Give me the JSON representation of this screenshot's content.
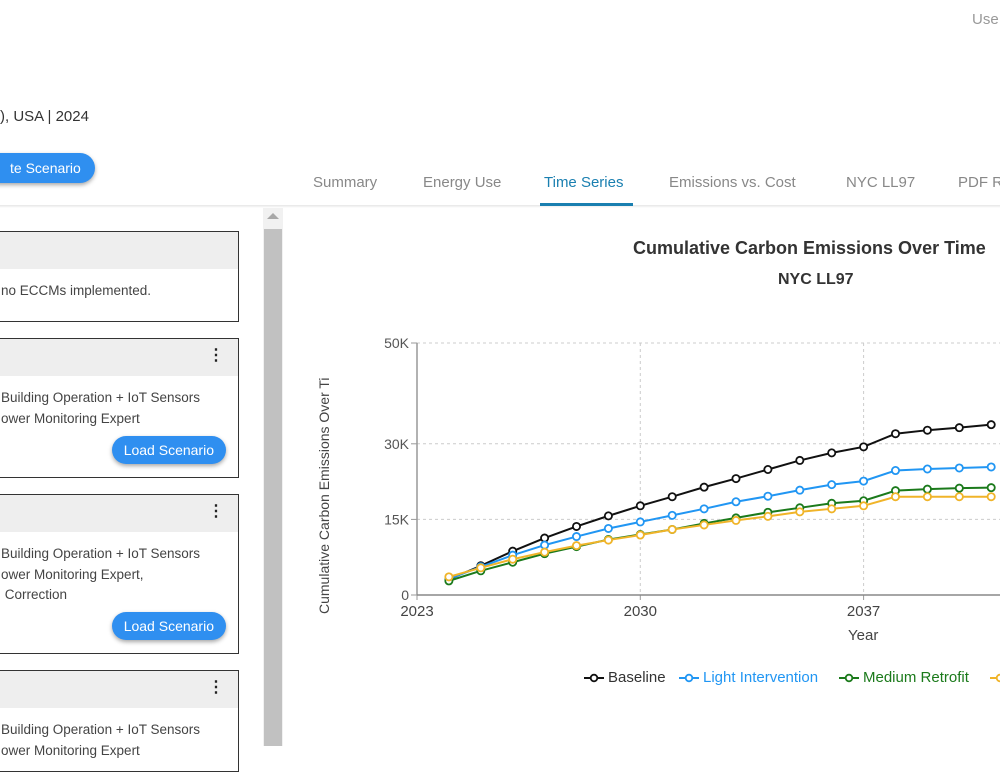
{
  "header": {
    "user_label": "Use",
    "subtitle": "), USA | 2024",
    "create_button": "te Scenario"
  },
  "tabs": [
    {
      "label": "Summary",
      "active": false
    },
    {
      "label": "Energy Use",
      "active": false
    },
    {
      "label": "Time Series",
      "active": true
    },
    {
      "label": "Emissions vs. Cost",
      "active": false
    },
    {
      "label": "NYC LL97",
      "active": false
    },
    {
      "label": "PDF R",
      "active": false
    }
  ],
  "scenarios": [
    {
      "lines": [
        "no ECCMs implemented."
      ],
      "has_menu": false,
      "load_label": ""
    },
    {
      "lines": [
        "Building Operation + IoT Sensors",
        "ower Monitoring Expert"
      ],
      "has_menu": true,
      "load_label": "Load Scenario"
    },
    {
      "lines": [
        "Building Operation + IoT Sensors",
        "ower Monitoring Expert,",
        " Correction"
      ],
      "has_menu": true,
      "load_label": "Load Scenario"
    },
    {
      "lines": [
        "Building Operation + IoT Sensors",
        "ower Monitoring Expert"
      ],
      "has_menu": true,
      "load_label": ""
    }
  ],
  "chart_data": {
    "type": "line",
    "title": "Cumulative Carbon Emissions Over Time",
    "subtitle": "NYC LL97",
    "xlabel": "Year",
    "ylabel": "Cumulative Carbon Emissions Over Ti",
    "x_ticks": [
      "2023",
      "2030",
      "2037"
    ],
    "y_ticks": [
      {
        "value": 0,
        "label": "0"
      },
      {
        "value": 15000,
        "label": "15K"
      },
      {
        "value": 30000,
        "label": "30K"
      },
      {
        "value": 50000,
        "label": "50K"
      }
    ],
    "ylim": [
      0,
      50000
    ],
    "grid": true,
    "legend_position": "bottom",
    "x": [
      2024,
      2025,
      2026,
      2027,
      2028,
      2029,
      2030,
      2031,
      2032,
      2033,
      2034,
      2035,
      2036,
      2037,
      2038,
      2039,
      2040,
      2041
    ],
    "series": [
      {
        "name": "Baseline",
        "color": "#111111",
        "values": [
          3100,
          5800,
          8700,
          11300,
          13600,
          15700,
          17700,
          19500,
          21400,
          23100,
          24900,
          26700,
          28200,
          29400,
          32000,
          32700,
          33200,
          33800
        ]
      },
      {
        "name": "Light Intervention",
        "color": "#2196f3",
        "values": [
          3200,
          5600,
          7900,
          9900,
          11600,
          13200,
          14500,
          15800,
          17100,
          18500,
          19600,
          20800,
          21900,
          22600,
          24700,
          25000,
          25200,
          25400
        ]
      },
      {
        "name": "Medium Retrofit",
        "color": "#1b7a1b",
        "values": [
          2800,
          4800,
          6500,
          8200,
          9600,
          11000,
          12000,
          13000,
          14200,
          15300,
          16400,
          17300,
          18200,
          18700,
          20700,
          21000,
          21200,
          21300
        ]
      },
      {
        "name": "",
        "color": "#f0b429",
        "values": [
          3600,
          5400,
          7100,
          8500,
          9800,
          10900,
          11900,
          13000,
          13900,
          14800,
          15600,
          16500,
          17100,
          17700,
          19500,
          19500,
          19500,
          19500
        ]
      }
    ]
  }
}
